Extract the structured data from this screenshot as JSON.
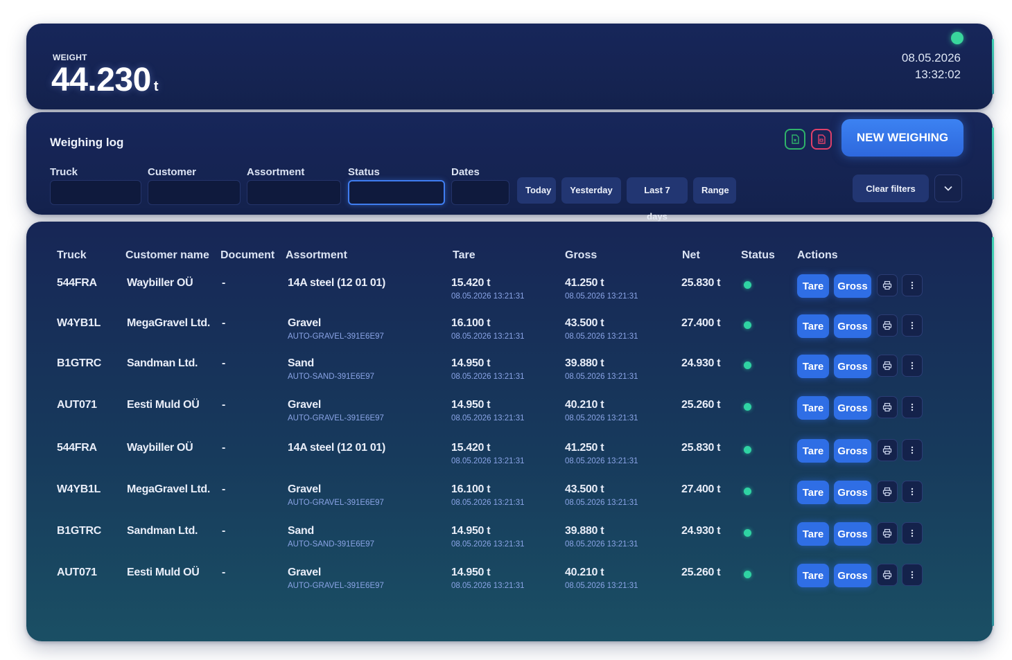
{
  "header": {
    "weight_label": "WEIGHT",
    "weight_value": "44.230",
    "weight_unit": "t",
    "date": "08.05.2026",
    "time": "13:32:02",
    "status_color": "#39d69c"
  },
  "filters": {
    "title": "Weighing log",
    "labels": {
      "truck": "Truck",
      "customer": "Customer",
      "assortment": "Assortment",
      "status": "Status",
      "dates": "Dates"
    },
    "values": {
      "truck": "",
      "customer": "",
      "assortment": "",
      "status": "",
      "dates": ""
    },
    "quick_dates": [
      "Today",
      "Yesterday",
      "Last 7 days",
      "Range"
    ],
    "new_weighing_label": "NEW WEIGHING",
    "clear_filters_label": "Clear filters",
    "export_icons": [
      "excel-export-icon",
      "pdf-export-icon"
    ]
  },
  "table": {
    "columns": [
      "Truck",
      "Customer name",
      "Document",
      "Assortment",
      "Tare",
      "Gross",
      "Net",
      "Status",
      "Actions"
    ],
    "action_labels": {
      "tare": "Tare",
      "gross": "Gross"
    },
    "rows": [
      {
        "truck": "544FRA",
        "customer": "Waybiller OÜ",
        "document": "-",
        "assortment": "14A steel (12 01 01)",
        "assortment_code": "",
        "tare": "15.420 t",
        "tare_time": "08.05.2026 13:21:31",
        "gross": "41.250 t",
        "gross_time": "08.05.2026 13:21:31",
        "net": "25.830 t",
        "status": "ok"
      },
      {
        "truck": "W4YB1L",
        "customer": "MegaGravel Ltd.",
        "document": "-",
        "assortment": "Gravel",
        "assortment_code": "AUTO-GRAVEL-391E6E97",
        "tare": "16.100 t",
        "tare_time": "08.05.2026 13:21:31",
        "gross": "43.500 t",
        "gross_time": "08.05.2026 13:21:31",
        "net": "27.400 t",
        "status": "ok"
      },
      {
        "truck": "B1GTRC",
        "customer": "Sandman Ltd.",
        "document": "-",
        "assortment": "Sand",
        "assortment_code": "AUTO-SAND-391E6E97",
        "tare": "14.950 t",
        "tare_time": "08.05.2026 13:21:31",
        "gross": "39.880 t",
        "gross_time": "08.05.2026 13:21:31",
        "net": "24.930 t",
        "status": "ok"
      },
      {
        "truck": "AUT071",
        "customer": "Eesti Muld OÜ",
        "document": "-",
        "assortment": "Gravel",
        "assortment_code": "AUTO-GRAVEL-391E6E97",
        "tare": "14.950 t",
        "tare_time": "08.05.2026 13:21:31",
        "gross": "40.210 t",
        "gross_time": "08.05.2026 13:21:31",
        "net": "25.260 t",
        "status": "ok"
      },
      {
        "truck": "544FRA",
        "customer": "Waybiller OÜ",
        "document": "-",
        "assortment": "14A steel (12 01 01)",
        "assortment_code": "",
        "tare": "15.420 t",
        "tare_time": "08.05.2026 13:21:31",
        "gross": "41.250 t",
        "gross_time": "08.05.2026 13:21:31",
        "net": "25.830 t",
        "status": "ok"
      },
      {
        "truck": "W4YB1L",
        "customer": "MegaGravel Ltd.",
        "document": "-",
        "assortment": "Gravel",
        "assortment_code": "AUTO-GRAVEL-391E6E97",
        "tare": "16.100 t",
        "tare_time": "08.05.2026 13:21:31",
        "gross": "43.500 t",
        "gross_time": "08.05.2026 13:21:31",
        "net": "27.400 t",
        "status": "ok"
      },
      {
        "truck": "B1GTRC",
        "customer": "Sandman Ltd.",
        "document": "-",
        "assortment": "Sand",
        "assortment_code": "AUTO-SAND-391E6E97",
        "tare": "14.950 t",
        "tare_time": "08.05.2026 13:21:31",
        "gross": "39.880 t",
        "gross_time": "08.05.2026 13:21:31",
        "net": "24.930 t",
        "status": "ok"
      },
      {
        "truck": "AUT071",
        "customer": "Eesti Muld OÜ",
        "document": "-",
        "assortment": "Gravel",
        "assortment_code": "AUTO-GRAVEL-391E6E97",
        "tare": "14.950 t",
        "tare_time": "08.05.2026 13:21:31",
        "gross": "40.210 t",
        "gross_time": "08.05.2026 13:21:31",
        "net": "25.260 t",
        "status": "ok"
      }
    ]
  },
  "colors": {
    "accent": "#2f6ee5",
    "status_ok": "#2fd3a3",
    "export_green": "#2fb36a",
    "export_red": "#e0416a"
  }
}
